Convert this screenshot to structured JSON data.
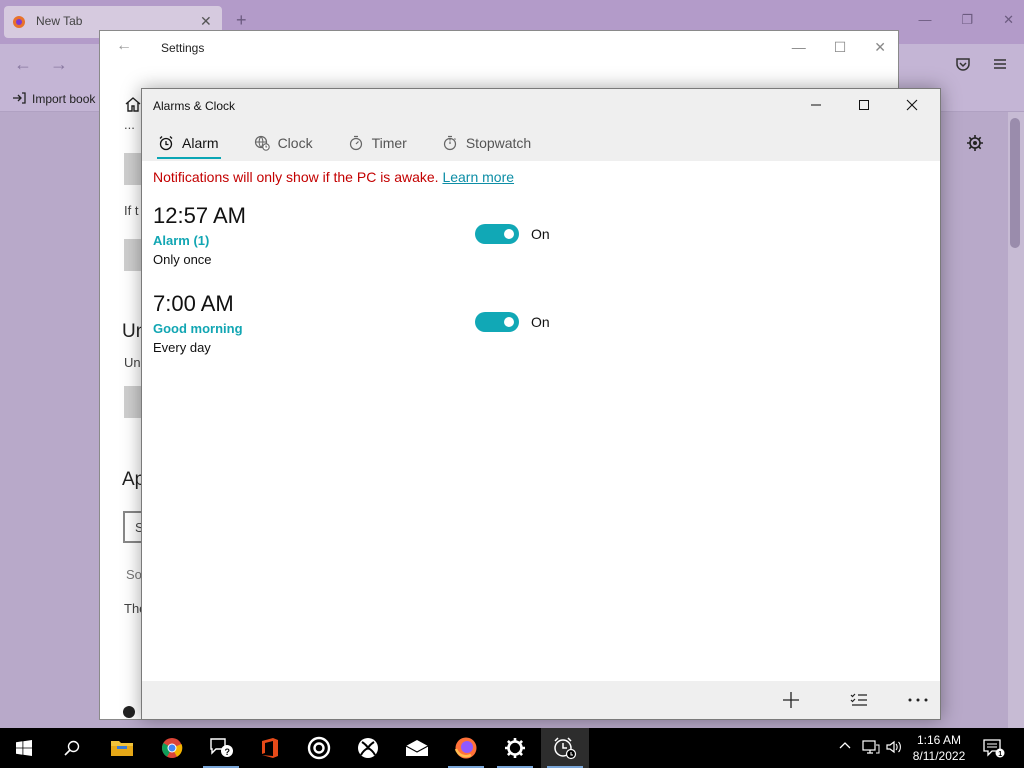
{
  "firefox": {
    "tab_title": "New Tab",
    "bookmark_label": "Import book"
  },
  "settings": {
    "title": "Settings",
    "fragments": [
      "If t",
      "Un",
      "Un",
      "Ap",
      "S",
      "So",
      "The"
    ]
  },
  "alarms_app": {
    "title": "Alarms & Clock",
    "tabs": [
      {
        "label": "Alarm",
        "icon": "alarm-clock-icon",
        "active": true
      },
      {
        "label": "Clock",
        "icon": "world-clock-icon",
        "active": false
      },
      {
        "label": "Timer",
        "icon": "timer-icon",
        "active": false
      },
      {
        "label": "Stopwatch",
        "icon": "stopwatch-icon",
        "active": false
      }
    ],
    "notice": {
      "text": "Notifications will only show if the PC is awake.",
      "link": "Learn more"
    },
    "alarms": [
      {
        "time": "12:57 AM",
        "name": "Alarm (1)",
        "repeat": "Only once",
        "toggle_label": "On",
        "enabled": true
      },
      {
        "time": "7:00 AM",
        "name": "Good morning",
        "repeat": "Every day",
        "toggle_label": "On",
        "enabled": true
      }
    ],
    "accent_color": "#11a8b6",
    "notice_color": "#c30000"
  },
  "taskbar": {
    "apps": [
      "start-icon",
      "search-icon",
      "file-explorer-icon",
      "chrome-icon",
      "feedback-hub-icon",
      "office-icon",
      "groove-music-icon",
      "xbox-icon",
      "mail-icon",
      "firefox-icon",
      "settings-icon",
      "alarms-clock-icon"
    ],
    "time": "1:16 AM",
    "date": "8/11/2022"
  }
}
